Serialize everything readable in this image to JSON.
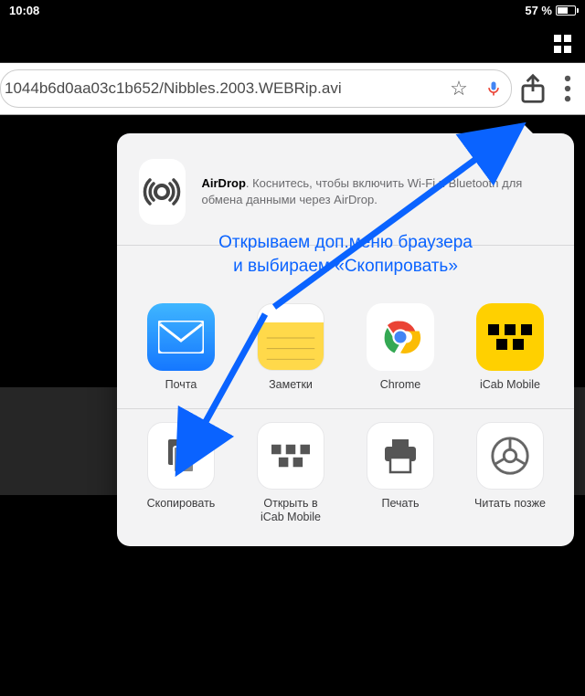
{
  "status": {
    "time": "10:08",
    "battery_pct": "57 %"
  },
  "toolbar": {
    "url": "1044b6d0aa03c1b652/Nibbles.2003.WEBRip.avi"
  },
  "airdrop": {
    "title": "AirDrop",
    "text": ". Коснитесь, чтобы включить Wi-Fi и Bluetooth для обмена данными через AirDrop."
  },
  "annotation": {
    "line1": "Открываем доп.меню браузера",
    "line2": "и выбираем «Скопировать»"
  },
  "apps": {
    "mail": "Почта",
    "notes": "Заметки",
    "chrome": "Chrome",
    "icab": "iCab Mobile"
  },
  "actions": {
    "copy": "Скопировать",
    "open_icab": "Открыть в\niCab Mobile",
    "print": "Печать",
    "read_later": "Читать позже"
  }
}
